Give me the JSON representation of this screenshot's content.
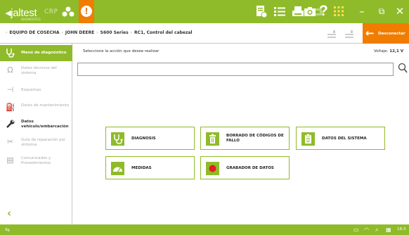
{
  "app": {
    "logo_main": "jaltest",
    "logo_sub": "DIAGNOSTICS",
    "module": "CRP"
  },
  "header": {
    "help_label": "?",
    "minimize_label": "–",
    "maximize_label": "⧉",
    "close_label": "✕"
  },
  "breadcrumb": {
    "items": [
      "EQUIPO DE COSECHA",
      "JOHN DEERE",
      "S600 Series",
      "RC1, Control del cabezal"
    ],
    "separator": "›"
  },
  "disconnect": {
    "label": "Desconectar"
  },
  "sidebar": {
    "items": [
      {
        "label": "Menú de diagnóstico",
        "icon": "stethoscope-icon",
        "state": "active"
      },
      {
        "label": "Datos técnicos del sistema",
        "icon": "omega-icon",
        "state": "disabled"
      },
      {
        "label": "Esquemas",
        "icon": "schematic-icon",
        "state": "disabled"
      },
      {
        "label": "Datos de mantenimiento",
        "icon": "oil-can-icon",
        "state": "disabled"
      },
      {
        "label": "Datos vehículo/embarcación",
        "icon": "wrench-icon",
        "state": "normal"
      },
      {
        "label": "Guía de reparación por síntoma",
        "icon": "tools-icon",
        "state": "disabled"
      },
      {
        "label": "Comunicados y Procedimientos",
        "icon": "documents-icon",
        "state": "disabled"
      }
    ],
    "collapse_label": "‹"
  },
  "main": {
    "instruction": "Seleccione la acción que desee realizar",
    "voltage_label": "Voltaje:",
    "voltage_value": "12,1 V",
    "search_value": "",
    "actions": [
      {
        "label": "DIAGNOSIS",
        "icon": "stethoscope-icon"
      },
      {
        "label": "BORRADO DE CÓDIGOS DE FALLO",
        "icon": "trash-icon"
      },
      {
        "label": "DATOS DEL SISTEMA",
        "icon": "clipboard-icon"
      },
      {
        "label": "MEDIDAS",
        "icon": "gauge-icon"
      },
      {
        "label": "GRABADOR DE DATOS",
        "icon": "record-icon"
      }
    ]
  },
  "status": {
    "time": "18:3"
  },
  "colors": {
    "brand_green": "#8fbb2a",
    "accent_orange": "#f07d00",
    "record_red": "#e02020"
  }
}
